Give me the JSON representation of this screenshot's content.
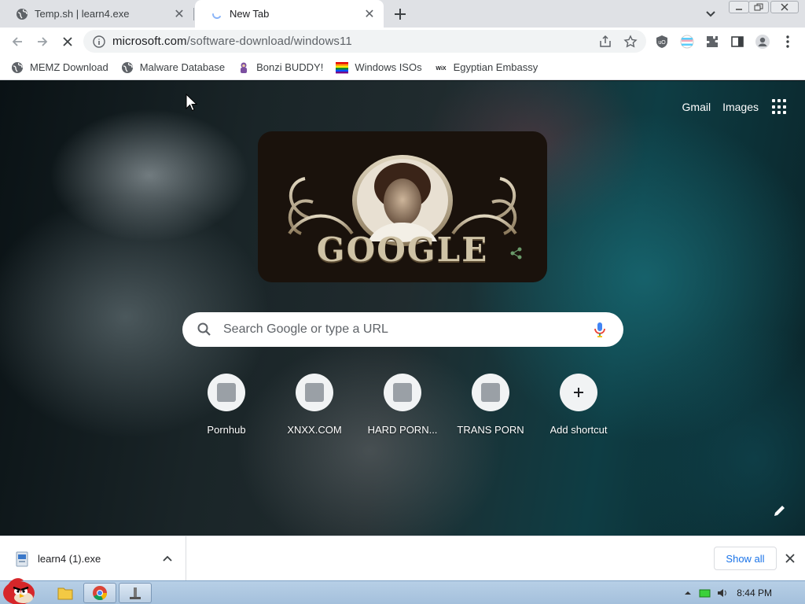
{
  "tabs": [
    {
      "title": "Temp.sh | learn4.exe",
      "icon": "globe-icon",
      "active": false
    },
    {
      "title": "New Tab",
      "icon": "loading-spinner-icon",
      "active": true
    }
  ],
  "toolbar": {
    "url_host": "microsoft.com",
    "url_path": "/software-download/windows11"
  },
  "bookmarks": [
    {
      "label": "MEMZ Download",
      "icon": "globe-icon"
    },
    {
      "label": "Malware Database",
      "icon": "globe-icon"
    },
    {
      "label": "Bonzi BUDDY!",
      "icon": "bonzi-icon"
    },
    {
      "label": "Windows ISOs",
      "icon": "rainbow-flag-icon"
    },
    {
      "label": "Egyptian Embassy",
      "icon": "wix-icon"
    }
  ],
  "ntp": {
    "gmail": "Gmail",
    "images": "Images",
    "doodle_text": "GOOGLE",
    "search_placeholder": "Search Google or type a URL",
    "shortcuts": [
      {
        "label": "Pornhub",
        "icon": "placeholder-site-icon"
      },
      {
        "label": "XNXX.COM",
        "icon": "placeholder-site-icon"
      },
      {
        "label": "HARD PORN...",
        "icon": "placeholder-site-icon"
      },
      {
        "label": "TRANS PORN",
        "icon": "placeholder-site-icon"
      },
      {
        "label": "Add shortcut",
        "icon": "plus-icon"
      }
    ]
  },
  "downloads": {
    "file": "learn4 (1).exe",
    "show_all": "Show all"
  },
  "taskbar": {
    "clock": "8:44 PM"
  },
  "colors": {
    "accent": "#1a73e8",
    "tabstrip": "#dfe1e5",
    "taskbar": "#b7cfe6"
  }
}
